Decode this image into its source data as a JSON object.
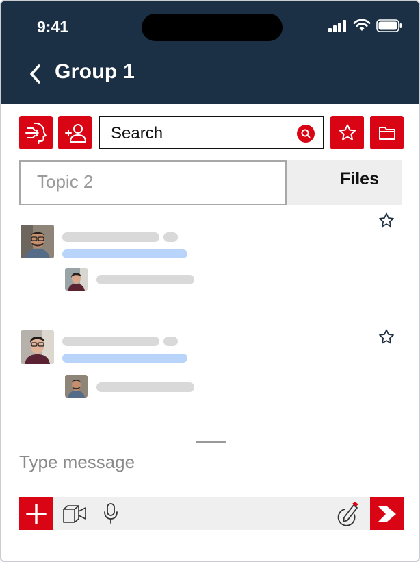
{
  "status_bar": {
    "time": "9:41"
  },
  "header": {
    "title": "Group 1"
  },
  "toolbar": {
    "buttons": [
      "ai-assistant",
      "add-member",
      "favorites",
      "folder"
    ],
    "search_placeholder": "Search"
  },
  "tabs": {
    "topic_label": "Topic 2",
    "files_label": "Files"
  },
  "messages": [
    {
      "sender": "bearded man with glasses",
      "reply_sender": "woman with dark hair",
      "starred": false
    },
    {
      "sender": "young man with glasses",
      "reply_sender": "bearded man with glasses",
      "starred": false
    }
  ],
  "composer": {
    "placeholder": "Type message"
  },
  "colors": {
    "header_bg": "#1b3044",
    "accent": "#d90414",
    "link_bar": "#b8d4fb"
  }
}
